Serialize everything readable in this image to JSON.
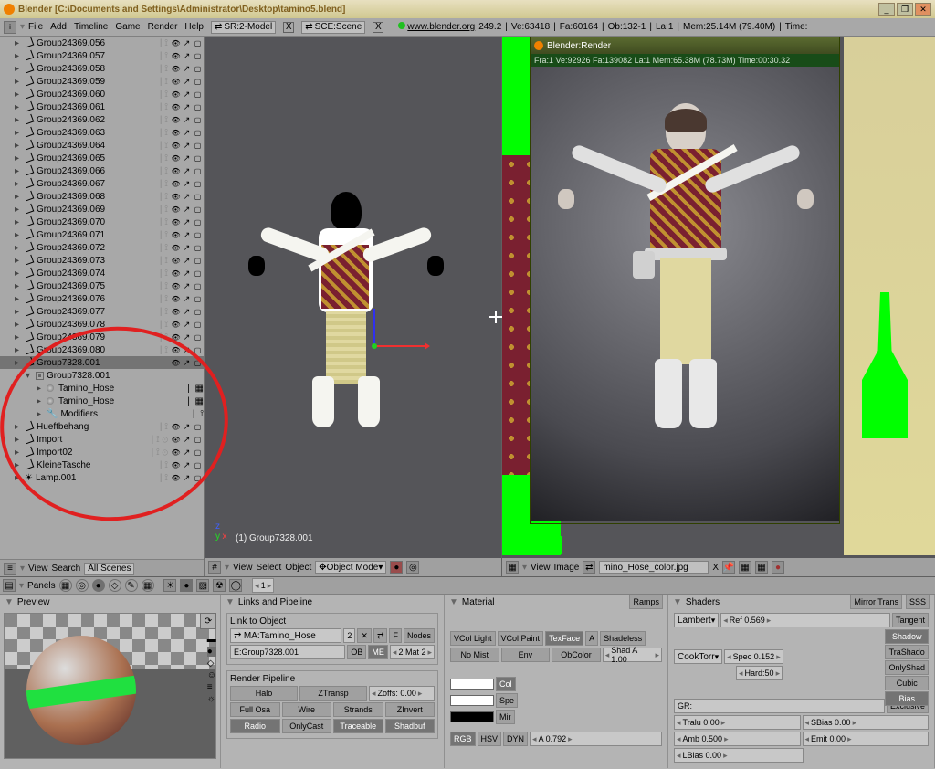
{
  "window": {
    "title": "Blender [C:\\Documents and Settings\\Administrator\\Desktop\\tamino5.blend]"
  },
  "menu": {
    "items": [
      "File",
      "Add",
      "Timeline",
      "Game",
      "Render",
      "Help"
    ],
    "screen_field": "SR:2-Model",
    "scene_field": "SCE:Scene",
    "link": "www.blender.org",
    "version": "249.2",
    "stats": {
      "ve": "Ve:63418",
      "fa": "Fa:60164",
      "ob": "Ob:132-1",
      "la": "La:1",
      "mem": "Mem:25.14M (79.40M)",
      "time": "Time:"
    },
    "x_label": "X"
  },
  "outliner": {
    "rows": [
      "Group24369.056",
      "Group24369.057",
      "Group24369.058",
      "Group24369.059",
      "Group24369.060",
      "Group24369.061",
      "Group24369.062",
      "Group24369.063",
      "Group24369.064",
      "Group24369.065",
      "Group24369.066",
      "Group24369.067",
      "Group24369.068",
      "Group24369.069",
      "Group24369.070",
      "Group24369.071",
      "Group24369.072",
      "Group24369.073",
      "Group24369.074",
      "Group24369.075",
      "Group24369.076",
      "Group24369.077",
      "Group24369.078",
      "Group24369.079",
      "Group24369.080"
    ],
    "selected": "Group7328.001",
    "child_mesh": "Group7328.001",
    "mat1": "Tamino_Hose",
    "mat2": "Tamino_Hose",
    "mod": "Modifiers",
    "others": [
      "Hueftbehang",
      "Import",
      "Import02",
      "KleineTasche",
      "Lamp.001"
    ],
    "foot": {
      "view": "View",
      "search": "Search",
      "mode": "All Scenes"
    }
  },
  "view3d": {
    "sel_label": "(1) Group7328.001",
    "foot": {
      "view": "View",
      "select": "Select",
      "object": "Object",
      "mode": "Object Mode"
    }
  },
  "uv": {
    "foot": {
      "view": "View",
      "image": "Image",
      "imgname": "mino_Hose_color.jpg"
    }
  },
  "render": {
    "title": "Blender:Render",
    "info": "Fra:1  Ve:92926 Fa:139082 La:1 Mem:65.38M (78.73M) Time:00:30.32"
  },
  "panelsHeader": {
    "panels_label": "Panels",
    "frame": "1"
  },
  "preview": {
    "title": "Preview"
  },
  "links": {
    "title": "Links and Pipeline",
    "link_to_object": "Link to Object",
    "ma_field": "MA:Tamino_Hose",
    "ma_users": "2",
    "nodes": "Nodes",
    "ob": "OB",
    "me": "ME",
    "matidx": "2 Mat 2",
    "ob_field": "E:Group7328.001",
    "render_pipeline": "Render Pipeline",
    "halo": "Halo",
    "ztransp": "ZTransp",
    "zoffs": "Zoffs: 0.00",
    "fullosa": "Full Osa",
    "wire": "Wire",
    "strands": "Strands",
    "zinvert": "ZInvert",
    "radio": "Radio",
    "onlycast": "OnlyCast",
    "traceable": "Traceable",
    "shadbuf": "Shadbuf",
    "f": "F",
    "x": "✕",
    "car": "⇄"
  },
  "material": {
    "title": "Material",
    "ramps": "Ramps",
    "vcollight": "VCol Light",
    "vcolpaint": "VCol Paint",
    "texface": "TexFace",
    "a": "A",
    "shadeless": "Shadeless",
    "nomist": "No Mist",
    "env": "Env",
    "obcolor": "ObColor",
    "shada": "Shad A 1.00",
    "col": "Col",
    "spe": "Spe",
    "mir": "Mir",
    "rgb": "RGB",
    "hsv": "HSV",
    "dyn": "DYN",
    "aval": "A 0.792"
  },
  "shaders": {
    "title": "Shaders",
    "mirror": "Mirror Trans",
    "sss": "SSS",
    "lambert": "Lambert",
    "ref": "Ref  0.569",
    "tangent": "Tangent",
    "cooktorr": "CookTorr",
    "spec": "Spec 0.152",
    "hard": "Hard:50",
    "shadow": "Shadow",
    "trashadow": "TraShado",
    "onlyshad": "OnlyShad",
    "cubic": "Cubic",
    "bias": "Bias",
    "gr": "GR:",
    "exclusive": "Exclusive",
    "tralu": "Tralu 0.00",
    "sbias": "SBias 0.00",
    "amb": "Amb 0.500",
    "emit": "Emit 0.00",
    "lbias": "LBias 0.00"
  }
}
